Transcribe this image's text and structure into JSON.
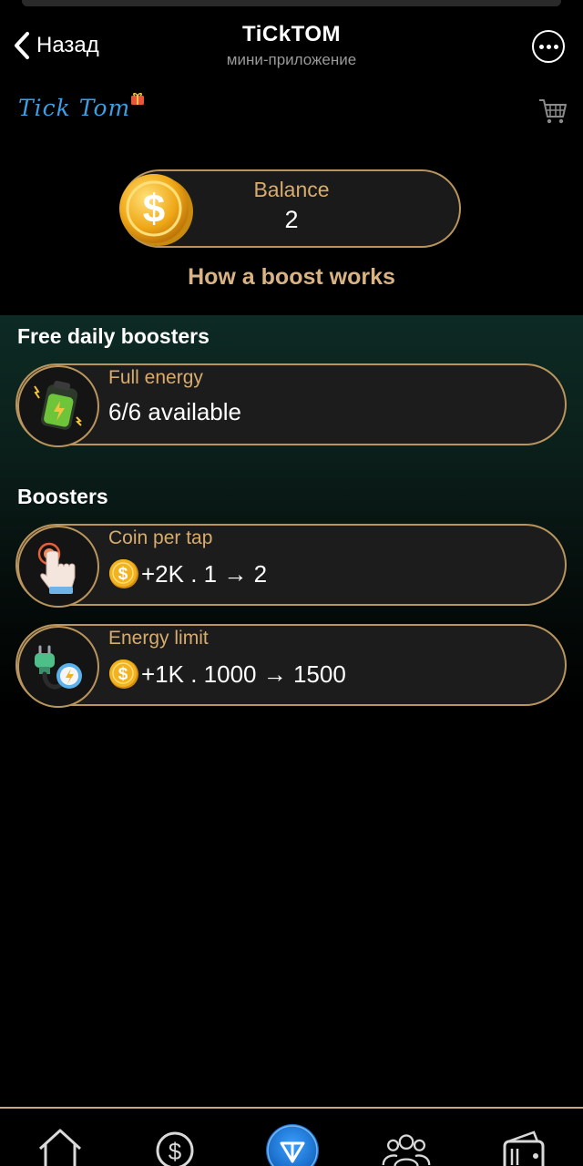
{
  "header": {
    "back_label": "Назад",
    "title": "TiCkTOM",
    "subtitle": "мини-приложение"
  },
  "app": {
    "logo_text": "Tick Tom"
  },
  "balance": {
    "label": "Balance",
    "value": "2"
  },
  "how_boost_label": "How a boost works",
  "free_daily": {
    "title": "Free daily boosters",
    "items": [
      {
        "name": "Full energy",
        "value": "6/6 available",
        "icon": "battery-icon"
      }
    ]
  },
  "boosters": {
    "title": "Boosters",
    "items": [
      {
        "name": "Coin per tap",
        "value": "+2K . 1 → 2",
        "icon": "tap-hand-icon"
      },
      {
        "name": "Energy limit",
        "value": "+1K . 1000 → 1500",
        "icon": "plug-icon"
      }
    ]
  },
  "nav": {
    "items": [
      "home-icon",
      "coin-icon",
      "ton-icon",
      "friends-icon",
      "wallet-icon"
    ]
  },
  "colors": {
    "gold": "#b9955d",
    "gold_text": "#d7ac6d",
    "logo_blue": "#3b9fe6",
    "background": "#000000"
  }
}
